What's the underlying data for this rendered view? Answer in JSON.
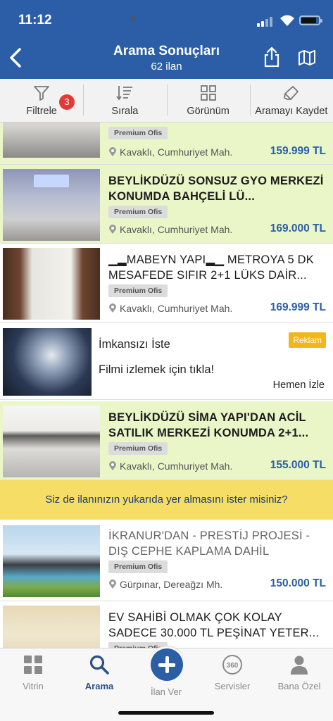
{
  "status_bar": {
    "time": "11:12"
  },
  "header": {
    "title": "Arama Sonuçları",
    "subtitle": "62 ilan"
  },
  "toolbar": {
    "filter": {
      "label": "Filtrele",
      "badge": "3"
    },
    "sort": {
      "label": "Sırala"
    },
    "view": {
      "label": "Görünüm"
    },
    "save_search": {
      "label": "Aramayı Kaydet"
    }
  },
  "listings": [
    {
      "title": "",
      "tag": "Premium Ofis",
      "location": "Kavaklı, Cumhuriyet Mah.",
      "price": "159.999 TL",
      "highlighted": true
    },
    {
      "title": "BEYLİKDÜZÜ SONSUZ GYO MERKEZİ KONUMDA BAHÇELİ LÜ...",
      "tag": "Premium Ofis",
      "location": "Kavaklı, Cumhuriyet Mah.",
      "price": "169.000 TL",
      "highlighted": true
    },
    {
      "title": "▁▂MABEYN YAPI▂▁ METROYA 5 DK MESAFEDE SIFIR 2+1 LÜKS DAİR...",
      "tag": "Premium Ofis",
      "location": "Kavaklı, Cumhuriyet Mah.",
      "price": "169.999 TL",
      "highlighted": false
    },
    {
      "title": "BEYLİKDÜZÜ SİMA YAPI'DAN ACİL SATILIK MERKEZİ KONUMDA 2+1...",
      "tag": "Premium Ofis",
      "location": "Kavaklı, Cumhuriyet Mah.",
      "price": "155.000 TL",
      "highlighted": true
    },
    {
      "title": "İKRANUR'DAN - PRESTİJ PROJESİ - DIŞ CEPHE KAPLAMA DAHİL",
      "tag": "Premium Ofis",
      "location": "Gürpınar, Dereağzı Mh.",
      "price": "150.000 TL",
      "highlighted": false
    },
    {
      "title": "EV SAHİBİ OLMAK ÇOK KOLAY SADECE 30.000 TL PEŞİNAT YETER...",
      "tag": "Premium Ofis",
      "location": "",
      "price": "",
      "highlighted": false
    }
  ],
  "ad": {
    "title": "İmkansızı İste",
    "subtitle": "Filmi izlemek için tıkla!",
    "badge": "Reklam",
    "cta": "Hemen İzle"
  },
  "promo_banner": "Siz de ilanınızın yukarıda yer almasını ister misiniz?",
  "tab_bar": {
    "items": [
      {
        "label": "Vitrin",
        "icon": "grid-icon"
      },
      {
        "label": "Arama",
        "icon": "search-icon",
        "active": true
      },
      {
        "label": "İlan Ver",
        "icon": "plus-icon"
      },
      {
        "label": "Servisler",
        "icon": "360-icon"
      },
      {
        "label": "Bana Özel",
        "icon": "person-icon"
      }
    ]
  },
  "colors": {
    "header": "#2b5ea6",
    "highlight_row": "#eaf6c8",
    "price": "#2b5ea6",
    "promo_banner": "#f5dd66",
    "badge": "#e53935",
    "ad_badge": "#f4b51b"
  }
}
